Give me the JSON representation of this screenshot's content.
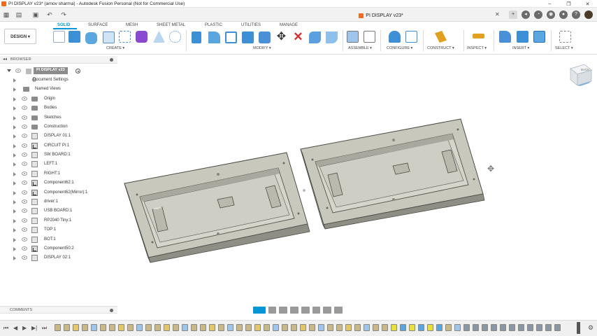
{
  "window": {
    "title": "PI DISPLAY v23* (arnov sharma) - Autodesk Fusion Personal (Not for Commercial Use)",
    "controls": [
      "–",
      "❐",
      "✕"
    ]
  },
  "document": {
    "tab_title": "PI DISPLAY v23*"
  },
  "toolbar": {
    "workspace": "DESIGN ▾",
    "tabs": [
      {
        "label": "SOLID",
        "active": true
      },
      {
        "label": "SURFACE",
        "active": false
      },
      {
        "label": "MESH",
        "active": false
      },
      {
        "label": "SHEET METAL",
        "active": false
      },
      {
        "label": "PLASTIC",
        "active": false
      },
      {
        "label": "UTILITIES",
        "active": false
      },
      {
        "label": "MANAGE",
        "active": false
      }
    ],
    "groups": [
      {
        "label": "CREATE ▾"
      },
      {
        "label": "MODIFY ▾"
      },
      {
        "label": "ASSEMBLE ▾"
      },
      {
        "label": "CONFIGURE ▾"
      },
      {
        "label": "CONSTRUCT ▾"
      },
      {
        "label": "INSPECT ▾"
      },
      {
        "label": "INSERT ▾"
      },
      {
        "label": "SELECT ▾"
      }
    ],
    "accent_color": "#0696d7"
  },
  "browser": {
    "header": "BROWSER",
    "root": "PI DISPLAY v23",
    "items": [
      {
        "label": "Document Settings",
        "icon": "gear-icon"
      },
      {
        "label": "Named Views",
        "icon": "folder-icon"
      },
      {
        "label": "Origin",
        "icon": "folder-icon"
      },
      {
        "label": "Bodies",
        "icon": "folder-icon"
      },
      {
        "label": "Sketches",
        "icon": "folder-icon"
      },
      {
        "label": "Construction",
        "icon": "folder-icon"
      },
      {
        "label": "DISPLAY 01:1",
        "icon": "component-icon"
      },
      {
        "label": "CIRCUIT Pi:1",
        "icon": "linked-component-icon"
      },
      {
        "label": "SW BOARD:1",
        "icon": "component-icon"
      },
      {
        "label": "LEFT:1",
        "icon": "component-icon"
      },
      {
        "label": "RIGHT:1",
        "icon": "component-icon"
      },
      {
        "label": "Component62:1",
        "icon": "linked-component-icon"
      },
      {
        "label": "Component62(Mirror):1",
        "icon": "linked-component-icon"
      },
      {
        "label": "driver:1",
        "icon": "component-icon"
      },
      {
        "label": "USB BOARD:1",
        "icon": "component-icon"
      },
      {
        "label": "RP2040 Tiny:1",
        "icon": "component-icon"
      },
      {
        "label": "TOP:1",
        "icon": "component-icon"
      },
      {
        "label": "BOT:1",
        "icon": "component-icon"
      },
      {
        "label": "Component50:2",
        "icon": "linked-component-icon"
      },
      {
        "label": "DISPLAY 02:1",
        "icon": "component-icon"
      }
    ]
  },
  "comments": {
    "header": "COMMENTS"
  },
  "viewcube": {
    "face": "BACK"
  }
}
